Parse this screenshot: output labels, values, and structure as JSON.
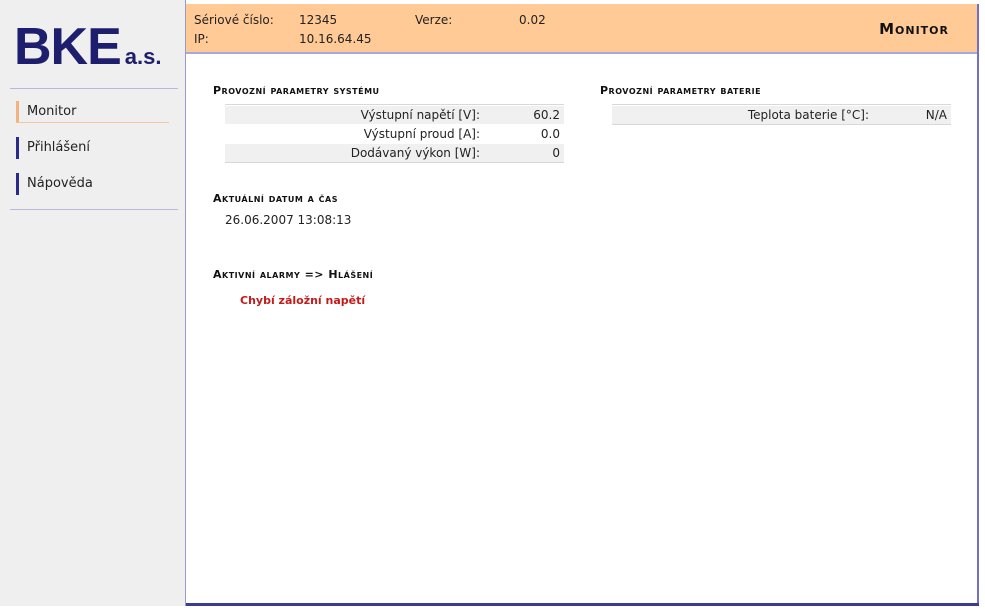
{
  "logo": {
    "main": "BKE",
    "suffix": "a.s."
  },
  "sidebar": {
    "items": [
      {
        "label": "Monitor"
      },
      {
        "label": "Přihlášení"
      },
      {
        "label": "Nápověda"
      }
    ]
  },
  "header": {
    "serial_label": "Sériové číslo:",
    "serial_value": "12345",
    "version_label": "Verze:",
    "version_value": "0.02",
    "ip_label": "IP:",
    "ip_value": "10.16.64.45",
    "title": "Monitor"
  },
  "system_params": {
    "title": "Provozní parametry systému",
    "rows": [
      {
        "label": "Výstupní napětí [V]:",
        "value": "60.2"
      },
      {
        "label": "Výstupní proud [A]:",
        "value": "0.0"
      },
      {
        "label": "Dodávaný výkon [W]:",
        "value": "0"
      }
    ]
  },
  "battery_params": {
    "title": "Provozní parametry baterie",
    "rows": [
      {
        "label": "Teplota baterie [°C]:",
        "value": "N/A"
      }
    ]
  },
  "datetime": {
    "title": "Aktuální datum a čas",
    "value": "26.06.2007 13:08:13"
  },
  "alarms": {
    "title_prefix": "Aktivní alarmy => ",
    "title_link": "Hlášení",
    "items": [
      "Chybí záložní napětí"
    ]
  },
  "colors": {
    "header_bg": "#ffca96",
    "sidebar_bg": "#efefef",
    "logo": "#1e1e6e",
    "alarm": "#c41a1a",
    "nav_marker": "#2a2a8a",
    "nav_active_marker": "#f2b37e"
  }
}
